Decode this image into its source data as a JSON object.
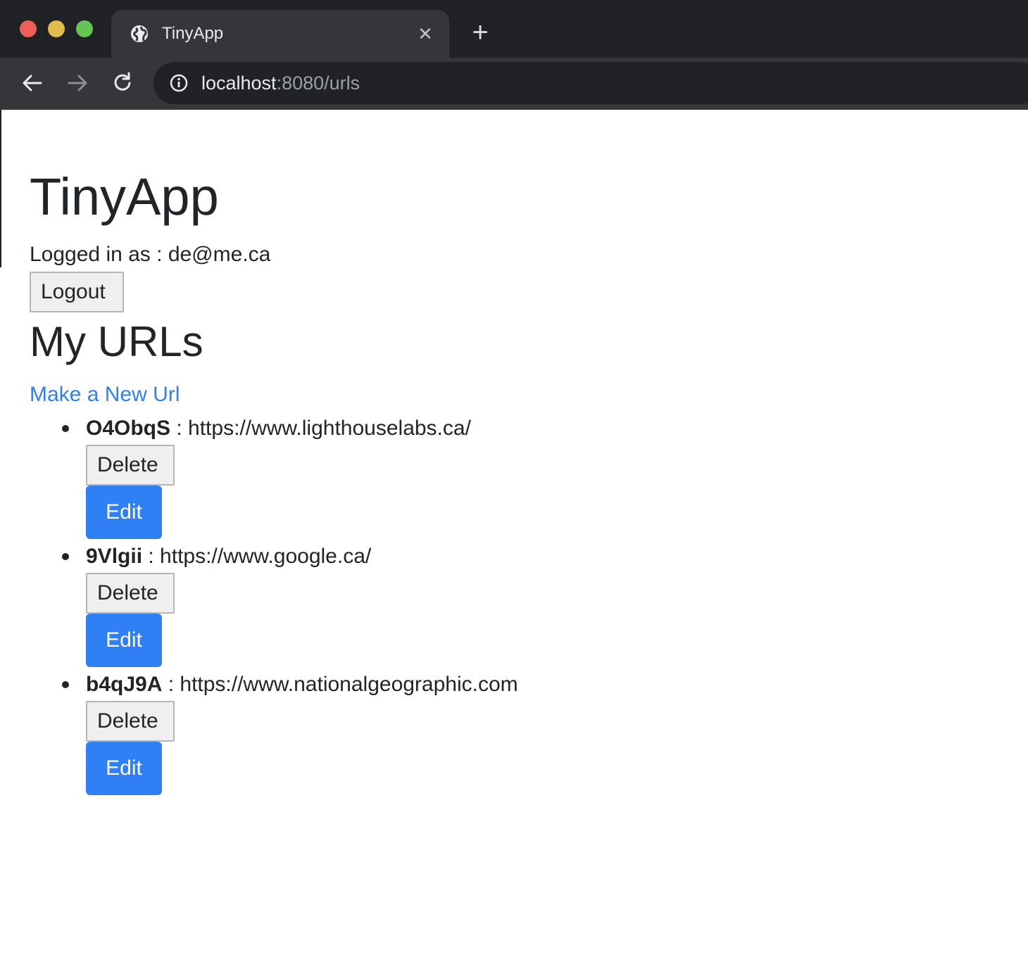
{
  "browser": {
    "tab": {
      "title": "TinyApp"
    },
    "address_bar": {
      "host": "localhost",
      "rest": ":8080/urls"
    }
  },
  "page": {
    "app_title": "TinyApp",
    "login_status": "Logged in as : de@me.ca",
    "logout_label": "Logout",
    "section_title": "My URLs",
    "new_url_link": "Make a New Url",
    "separator": " : ",
    "urls": [
      {
        "short": "O4ObqS",
        "long": "https://www.lighthouselabs.ca/",
        "delete_label": "Delete",
        "edit_label": "Edit"
      },
      {
        "short": "9Vlgii",
        "long": "https://www.google.ca/",
        "delete_label": "Delete",
        "edit_label": "Edit"
      },
      {
        "short": "b4qJ9A",
        "long": "https://www.nationalgeographic.com",
        "delete_label": "Delete",
        "edit_label": "Edit"
      }
    ]
  },
  "colors": {
    "link": "#2f7ff5",
    "primary_button": "#2f7ff5",
    "text": "#212529",
    "chrome_dark": "#202124",
    "chrome_toolbar": "#35363a"
  },
  "icons": [
    "globe-icon",
    "close-icon",
    "plus-icon",
    "back-arrow-icon",
    "forward-arrow-icon",
    "reload-icon",
    "info-icon"
  ]
}
